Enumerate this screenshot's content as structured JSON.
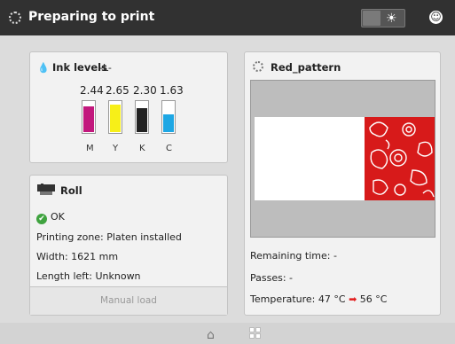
{
  "header": {
    "title": "Preparing to print",
    "theme_icon": "sun-icon",
    "user_icon": "smiley-icon"
  },
  "ink": {
    "title": "Ink levels",
    "subtitle": "-L-",
    "cartridges": [
      {
        "label": "M",
        "value": "2.44",
        "level": 0.8,
        "color": "#c2187d"
      },
      {
        "label": "Y",
        "value": "2.65",
        "level": 0.85,
        "color": "#f7ef18"
      },
      {
        "label": "K",
        "value": "2.30",
        "level": 0.75,
        "color": "#222222"
      },
      {
        "label": "C",
        "value": "1.63",
        "level": 0.55,
        "color": "#1ea7e4"
      }
    ]
  },
  "roll": {
    "title": "Roll",
    "status": "OK",
    "zone_label": "Printing zone:",
    "zone_value": "Platen installed",
    "width_label": "Width:",
    "width_value": "1621 mm",
    "length_label": "Length left:",
    "length_value": "Unknown",
    "manual_load": "Manual load"
  },
  "job": {
    "title": "Red_pattern",
    "remaining_label": "Remaining time:",
    "remaining_value": "-",
    "passes_label": "Passes:",
    "passes_value": "-",
    "temp_label": "Temperature:",
    "temp_current": "47",
    "temp_target": "56",
    "temp_unit": "°C"
  },
  "nav": {
    "home_icon": "home-icon",
    "apps_icon": "grid-icon"
  },
  "colors": {
    "topbar": "#313131",
    "ok": "#3fa33f",
    "pattern": "#d71a1a",
    "arrow": "#e21b1b"
  }
}
